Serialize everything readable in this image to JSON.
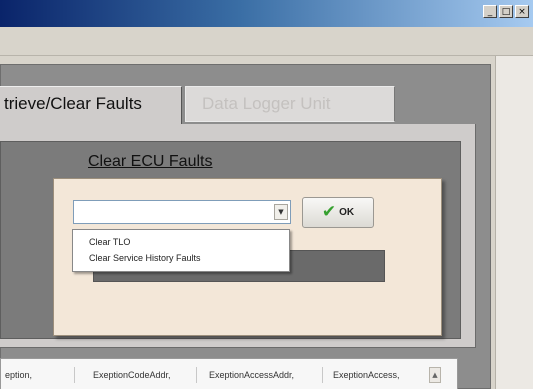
{
  "window": {
    "minimize": "_",
    "maximize": "□",
    "close": "×"
  },
  "tabs": [
    {
      "label": "trieve/Clear Faults",
      "active": true
    },
    {
      "label": "Data Logger Unit",
      "active": false
    }
  ],
  "clear_panel": {
    "title": "Clear ECU Faults",
    "combo_value": "",
    "combo_arrow": "▼",
    "ok_icon": "✔",
    "ok_label": "OK",
    "options": [
      "Clear TLO",
      "Clear Service History Faults"
    ]
  },
  "table": {
    "columns": [
      "eption,",
      "ExeptionCodeAddr,",
      "ExeptionAccessAddr,",
      "ExeptionAccess,"
    ],
    "scroll_up": "▲"
  },
  "colors": {
    "titlebar_start": "#0a246a",
    "titlebar_end": "#a6caf0",
    "panel_gray": "#7b7b7b",
    "cream": "#f3e7d8",
    "ok_check": "#36a02f"
  }
}
